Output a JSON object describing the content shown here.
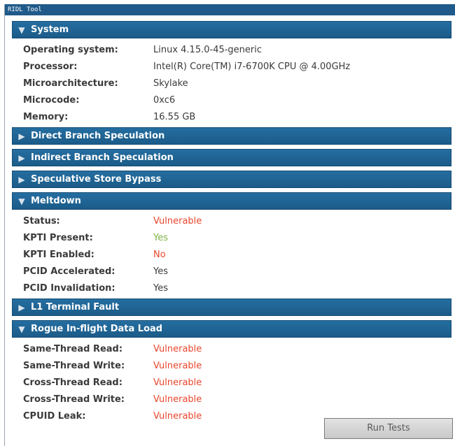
{
  "window": {
    "title": "RIDL Tool"
  },
  "colors": {
    "header": "#1b5b88",
    "vulnerable": "#e8452c",
    "safe": "#7cb342",
    "normal": "#3a3a3a"
  },
  "sections": {
    "system": {
      "title": "System",
      "expanded": true,
      "rows": [
        {
          "label": "Operating system:",
          "value": "Linux 4.15.0-45-generic"
        },
        {
          "label": "Processor:",
          "value": "Intel(R) Core(TM) i7-6700K CPU @ 4.00GHz"
        },
        {
          "label": "Microarchitecture:",
          "value": "Skylake"
        },
        {
          "label": "Microcode:",
          "value": "0xc6"
        },
        {
          "label": "Memory:",
          "value": "16.55 GB"
        }
      ]
    },
    "direct_branch": {
      "title": "Direct Branch Speculation",
      "expanded": false
    },
    "indirect_branch": {
      "title": "Indirect Branch Speculation",
      "expanded": false
    },
    "store_bypass": {
      "title": "Speculative Store Bypass",
      "expanded": false
    },
    "meltdown": {
      "title": "Meltdown",
      "expanded": true,
      "rows": [
        {
          "label": "Status:",
          "value": "Vulnerable",
          "status": "vulnerable"
        },
        {
          "label": "KPTI Present:",
          "value": "Yes",
          "status": "safe"
        },
        {
          "label": "KPTI Enabled:",
          "value": "No",
          "status": "vulnerable"
        },
        {
          "label": "PCID Accelerated:",
          "value": "Yes",
          "status": "normal"
        },
        {
          "label": "PCID Invalidation:",
          "value": "Yes",
          "status": "normal"
        }
      ]
    },
    "l1tf": {
      "title": "L1 Terminal Fault",
      "expanded": false
    },
    "ridl": {
      "title": "Rogue In-flight Data Load",
      "expanded": true,
      "rows": [
        {
          "label": "Same-Thread Read:",
          "value": "Vulnerable",
          "status": "vulnerable"
        },
        {
          "label": "Same-Thread Write:",
          "value": "Vulnerable",
          "status": "vulnerable"
        },
        {
          "label": "Cross-Thread Read:",
          "value": "Vulnerable",
          "status": "vulnerable"
        },
        {
          "label": "Cross-Thread Write:",
          "value": "Vulnerable",
          "status": "vulnerable"
        },
        {
          "label": "CPUID Leak:",
          "value": "Vulnerable",
          "status": "vulnerable"
        }
      ]
    }
  },
  "icons": {
    "expanded": "triangle-down-icon",
    "collapsed": "triangle-right-icon"
  },
  "run_button": {
    "label": "Run Tests"
  }
}
